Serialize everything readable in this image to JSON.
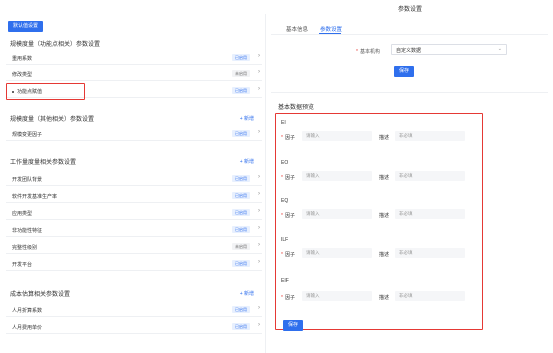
{
  "header": {
    "title": "参数设置"
  },
  "left": {
    "default_button": "默认值设置",
    "sections": [
      {
        "title": "规模度量（功能点相关）参数设置",
        "add_label": "",
        "rows": [
          {
            "label": "重用系数",
            "status": "已启用",
            "used": true
          },
          {
            "label": "修改类型",
            "status": "未启用",
            "used": false
          },
          {
            "label": "功能点赋值",
            "status": "已启用",
            "used": true,
            "bullet": true
          }
        ]
      },
      {
        "title": "规模度量（其他相关）参数设置",
        "add_label": "+ 新增",
        "rows": [
          {
            "label": "规模变更因子",
            "status": "已启用",
            "used": true
          }
        ]
      },
      {
        "title": "工作量度量相关参数设置",
        "add_label": "+ 新增",
        "rows": [
          {
            "label": "开发团队背景",
            "status": "已启用",
            "used": true
          },
          {
            "label": "软件开发基准生产率",
            "status": "已启用",
            "used": true
          },
          {
            "label": "应用类型",
            "status": "已启用",
            "used": true
          },
          {
            "label": "非功能性特征",
            "status": "已启用",
            "used": true
          },
          {
            "label": "完整性级别",
            "status": "未启用",
            "used": false
          },
          {
            "label": "开发平台",
            "status": "已启用",
            "used": true
          }
        ]
      },
      {
        "title": "成本估算相关参数设置",
        "add_label": "+ 新增",
        "rows": [
          {
            "label": "人月折算系数",
            "status": "已启用",
            "used": true
          },
          {
            "label": "人月费用单价",
            "status": "已启用",
            "used": true
          }
        ]
      }
    ]
  },
  "right": {
    "tabs": [
      "基本信息",
      "参数设置"
    ],
    "active_tab": 1,
    "org_label": "基本机构",
    "org_value": "自定义数据",
    "save_label": "保存",
    "preview_title": "基本数据预览",
    "factor_label": "因子",
    "factor_placeholder": "请输入",
    "desc_label": "描述",
    "desc_placeholder": "非必填",
    "groups": [
      "EI",
      "EO",
      "EQ",
      "ILF",
      "EIF"
    ],
    "bottom_save_label": "保存"
  },
  "colors": {
    "accent": "#2f6fed",
    "highlight": "#e53935",
    "required": "#e53935"
  }
}
